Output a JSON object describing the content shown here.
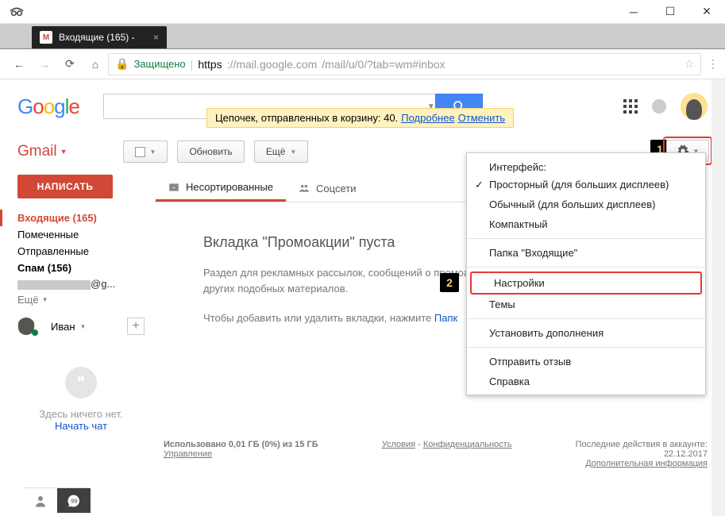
{
  "window": {
    "tab_title": "Входящие (165) -",
    "url_secure": "Защищено",
    "url_host": "https",
    "url_domain": "://mail.google.com",
    "url_path": "/mail/u/0/?tab=wm#inbox"
  },
  "header": {
    "logo_letters": [
      "G",
      "o",
      "o",
      "g",
      "l",
      "e"
    ],
    "search_value": ""
  },
  "toast": {
    "text": "Цепочек, отправленных в корзину: 40.",
    "more": "Подробнее",
    "undo": "Отменить"
  },
  "app": {
    "gmail": "Gmail",
    "refresh": "Обновить",
    "more": "Ещё"
  },
  "callouts": {
    "one": "1",
    "two": "2"
  },
  "sidebar": {
    "compose": "НАПИСАТЬ",
    "inbox": "Входящие (165)",
    "starred": "Помеченные",
    "sent": "Отправленные",
    "spam": "Спам (156)",
    "email_suffix": "@g...",
    "more": "Ещё",
    "user_name": "Иван",
    "empty_title": "Здесь ничего нет.",
    "start_chat": "Начать чат"
  },
  "tabs": {
    "primary": "Несортированные",
    "social": "Соцсети"
  },
  "main": {
    "empty_title": "Вкладка \"Промоакции\" пуста",
    "empty_desc": "Раздел для рекламных рассылок, сообщений о промоакциях и других подобных материалов.",
    "empty_hint_pre": "Чтобы добавить или удалить вкладки, нажмите ",
    "empty_hint_link": "Папк"
  },
  "menu": {
    "interface_label": "Интерфейс:",
    "comfort": "Просторный (для больших дисплеев)",
    "cozy": "Обычный (для больших дисплеев)",
    "compact": "Компактный",
    "inbox_folder": "Папка \"Входящие\"",
    "settings": "Настройки",
    "themes": "Темы",
    "addons": "Установить дополнения",
    "feedback": "Отправить отзыв",
    "help": "Справка"
  },
  "footer": {
    "storage": "Использовано 0,01 ГБ (0%) из 15 ГБ",
    "manage": "Управление",
    "terms": "Условия",
    "privacy": "Конфиденциальность",
    "activity_label": "Последние действия в аккаунте:",
    "activity_date": "22.12.2017",
    "activity_more": "Дополнительная информация"
  }
}
